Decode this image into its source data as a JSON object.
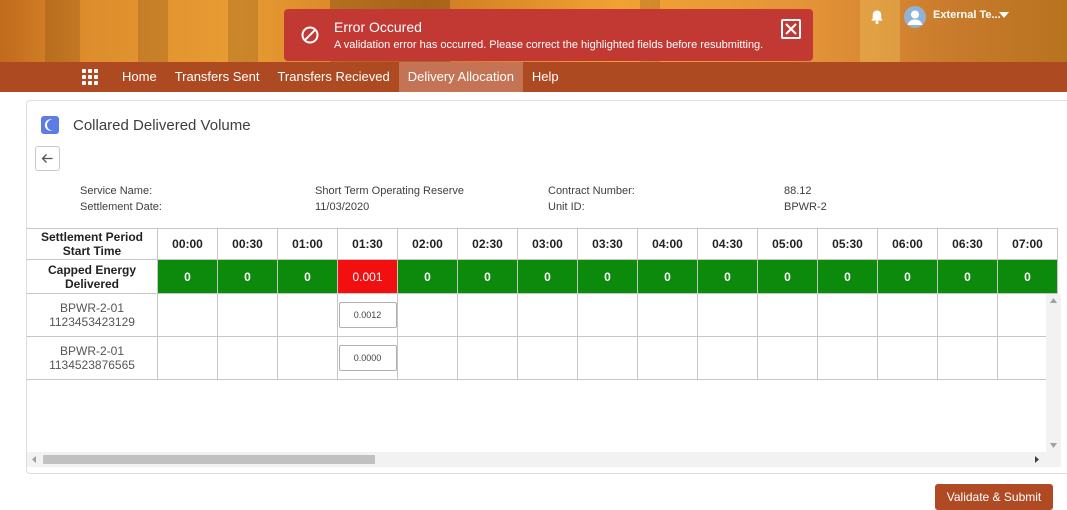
{
  "toast": {
    "title": "Error Occured",
    "message": "A validation error has occurred. Please correct the highlighted fields before resubmitting."
  },
  "header": {
    "user_name": "External Te..."
  },
  "nav": {
    "items": [
      {
        "label": "Home"
      },
      {
        "label": "Transfers Sent"
      },
      {
        "label": "Transfers Recieved"
      },
      {
        "label": "Delivery Allocation",
        "active": true
      },
      {
        "label": "Help"
      }
    ]
  },
  "card": {
    "title": "Collared Delivered Volume",
    "service_name_label": "Service Name:",
    "service_name_value": "Short Term Operating Reserve",
    "settlement_date_label": "Settlement Date:",
    "settlement_date_value": "11/03/2020",
    "contract_number_label": "Contract Number:",
    "contract_number_value": "88.12",
    "unit_id_label": "Unit ID:",
    "unit_id_value": "BPWR-2"
  },
  "table": {
    "header_label": "Settlement Period Start Time",
    "times": [
      "00:00",
      "00:30",
      "01:00",
      "01:30",
      "02:00",
      "02:30",
      "03:00",
      "03:30",
      "04:00",
      "04:30",
      "05:00",
      "05:30",
      "06:00",
      "06:30",
      "07:00"
    ],
    "capped_label": "Capped Energy Delivered",
    "capped_values": [
      "0",
      "0",
      "0",
      "0.001",
      "0",
      "0",
      "0",
      "0",
      "0",
      "0",
      "0",
      "0",
      "0",
      "0",
      "0"
    ],
    "capped_error_index": 3,
    "rows": [
      {
        "unit": "BPWR-2-01",
        "id": "1123453423129",
        "input_index": 3,
        "input_value": "0.0012"
      },
      {
        "unit": "BPWR-2-01",
        "id": "1134523876565",
        "input_index": 3,
        "input_value": "0.0000"
      }
    ]
  },
  "actions": {
    "submit_label": "Validate & Submit"
  },
  "colors": {
    "nav": "#ad4a22",
    "error": "#c23934",
    "valid_cell": "#0c8a0c",
    "invalid_cell": "#f20f0f",
    "button": "#b04a25"
  }
}
